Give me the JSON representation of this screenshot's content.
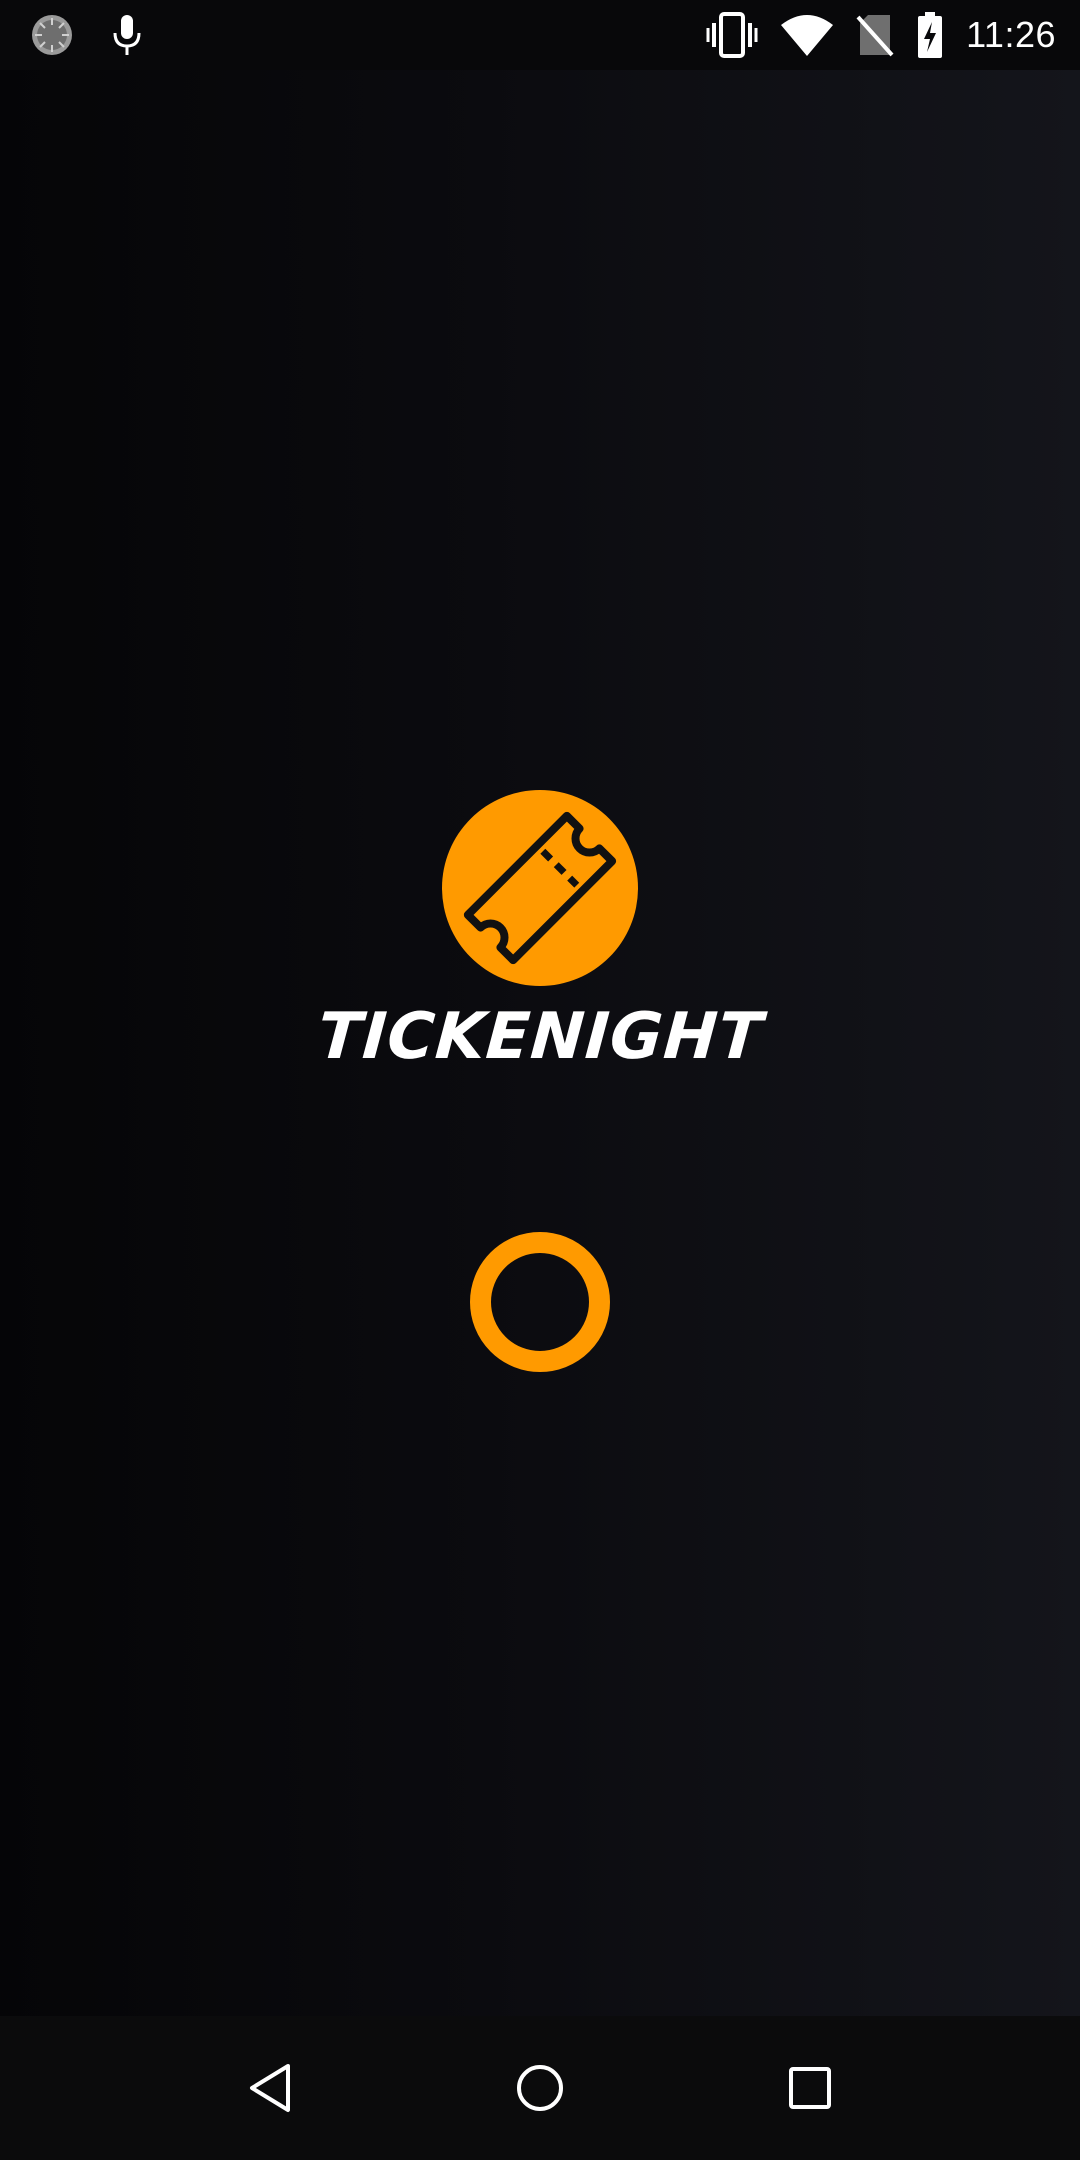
{
  "status_bar": {
    "time": "11:26",
    "icons": [
      "sync-icon",
      "microphone-icon",
      "vibrate-icon",
      "wifi-icon",
      "no-sim-icon",
      "battery-charging-icon"
    ]
  },
  "splash": {
    "brand_name": "TICKENIGHT",
    "logo_icon": "ticket-icon",
    "accent_color": "#ff9a00",
    "loading": true
  },
  "nav_bar": {
    "buttons": [
      "back-icon",
      "home-icon",
      "recents-icon"
    ]
  }
}
